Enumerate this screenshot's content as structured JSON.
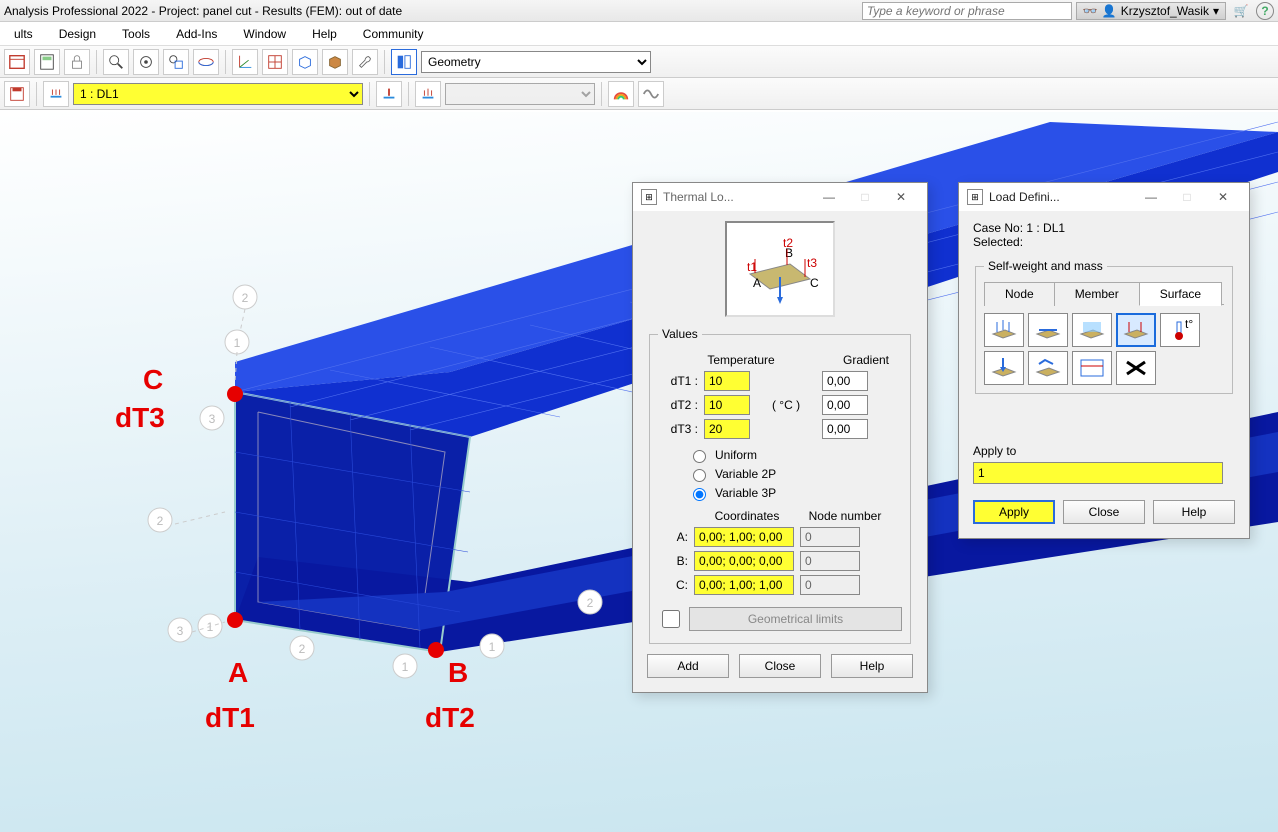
{
  "app": {
    "title": "Analysis Professional 2022 - Project: panel cut - Results (FEM): out of date",
    "search_placeholder": "Type a keyword or phrase",
    "user": "Krzysztof_Wasik"
  },
  "menu": [
    "ults",
    "Design",
    "Tools",
    "Add-Ins",
    "Window",
    "Help",
    "Community"
  ],
  "toolbar": {
    "geometry_dropdown": "Geometry",
    "loadcase": "1 : DL1"
  },
  "viewport": {
    "annotations": {
      "c": "C",
      "dt3": "dT3",
      "a": "A",
      "dt1": "dT1",
      "b": "B",
      "dt2": "dT2"
    }
  },
  "thermal_dialog": {
    "title": "Thermal Lo...",
    "values_legend": "Values",
    "temperature_col": "Temperature",
    "gradient_col": "Gradient",
    "unit": "( °C )",
    "rows": {
      "dt1_label": "dT1 :",
      "dt1_val": "10",
      "dt1_grad": "0,00",
      "dt2_label": "dT2 :",
      "dt2_val": "10",
      "dt2_grad": "0,00",
      "dt3_label": "dT3 :",
      "dt3_val": "20",
      "dt3_grad": "0,00"
    },
    "radio": {
      "uniform": "Uniform",
      "v2p": "Variable 2P",
      "v3p": "Variable 3P"
    },
    "coords_col": "Coordinates",
    "node_col": "Node number",
    "a_label": "A:",
    "a_val": "0,00; 1,00; 0,00",
    "a_node": "0",
    "b_label": "B:",
    "b_val": "0,00; 0,00; 0,00",
    "b_node": "0",
    "c_label": "C:",
    "c_val": "0,00; 1,00; 1,00",
    "c_node": "0",
    "geom_limits": "Geometrical limits",
    "add": "Add",
    "close": "Close",
    "help": "Help"
  },
  "load_dialog": {
    "title": "Load Defini...",
    "case_no": "Case No: 1 : DL1",
    "selected": "Selected:",
    "self_weight_legend": "Self-weight and mass",
    "tabs": {
      "node": "Node",
      "member": "Member",
      "surface": "Surface"
    },
    "apply_to_label": "Apply to",
    "apply_to_val": "1",
    "apply": "Apply",
    "close": "Close",
    "help": "Help"
  }
}
